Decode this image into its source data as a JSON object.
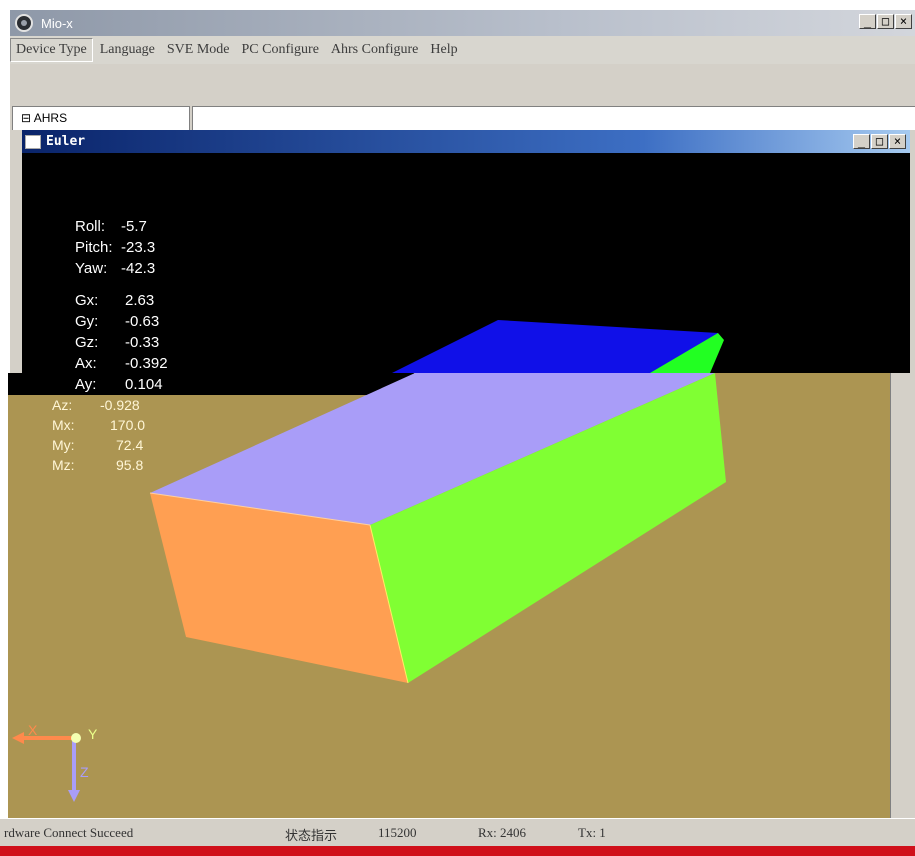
{
  "window": {
    "title": "Mio-x",
    "controls": {
      "minimize": "_",
      "maximize": "□",
      "close": "×"
    }
  },
  "menu": {
    "items": [
      {
        "label": "Device Type"
      },
      {
        "label": "Language"
      },
      {
        "label": "SVE Mode"
      },
      {
        "label": "PC Configure"
      },
      {
        "label": "Ahrs Configure"
      },
      {
        "label": "Help"
      }
    ]
  },
  "tree": {
    "root_label": "⊟ AHRS"
  },
  "euler": {
    "title": "Euler",
    "controls": {
      "minimize": "_",
      "maximize": "□",
      "close": "×"
    }
  },
  "readings": {
    "roll": {
      "label": "Roll:",
      "value": "-5.7"
    },
    "pitch": {
      "label": "Pitch:",
      "value": "-23.3"
    },
    "yaw": {
      "label": "Yaw:",
      "value": "-42.3"
    },
    "gx": {
      "label": "Gx:",
      "value": "2.63"
    },
    "gy": {
      "label": "Gy:",
      "value": "-0.63"
    },
    "gz": {
      "label": "Gz:",
      "value": "-0.33"
    },
    "ax": {
      "label": "Ax:",
      "value": "-0.392"
    },
    "ay": {
      "label": "Ay:",
      "value": "0.104"
    },
    "az": {
      "label": "Az:",
      "value": "-0.928"
    },
    "mx": {
      "label": "Mx:",
      "value": "170.0"
    },
    "my": {
      "label": "My:",
      "value": "72.4"
    },
    "mz": {
      "label": "Mz:",
      "value": "95.8"
    }
  },
  "axes": {
    "x_label": "X",
    "y_label": "Y",
    "z_label": "Z"
  },
  "status": {
    "connection": "rdware Connect Succeed",
    "indicator": "状态指示",
    "baud": "115200",
    "rx": "Rx: 2406",
    "tx": "Tx: 1"
  },
  "colors": {
    "box_top": "#a99df8",
    "box_front": "#ff9f52",
    "box_side": "#80ff33",
    "box_back_top": "#1010e8",
    "box_back_side": "#22ff22",
    "viewport_bg": "#ac9552",
    "axis_x": "#ff8a4c",
    "axis_z": "#a99df8"
  }
}
